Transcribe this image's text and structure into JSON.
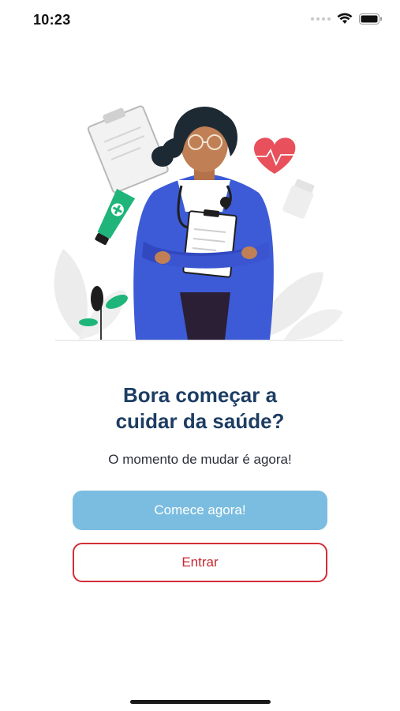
{
  "status_bar": {
    "time": "10:23",
    "icons": [
      "signal-dots-icon",
      "wifi-icon",
      "battery-icon"
    ]
  },
  "illustration": {
    "subject": "doctor-with-clipboard-illustration",
    "elements": [
      "clipboard-icon",
      "heart-icon",
      "ointment-tube-icon",
      "pill-bottle-icon",
      "plant-leaves-icon"
    ]
  },
  "onboarding": {
    "headline_line1": "Bora começar a",
    "headline_line2": "cuidar da saúde?",
    "subtitle": "O momento de mudar é agora!",
    "primary_button": "Comece agora!",
    "secondary_button": "Entrar"
  },
  "colors": {
    "headline": "#1d3d63",
    "primary_button": "#7bbde0",
    "secondary_border": "#d32d3a",
    "coat_blue": "#3d5bd6",
    "heart_red": "#e8505b",
    "green": "#1fb57a"
  }
}
